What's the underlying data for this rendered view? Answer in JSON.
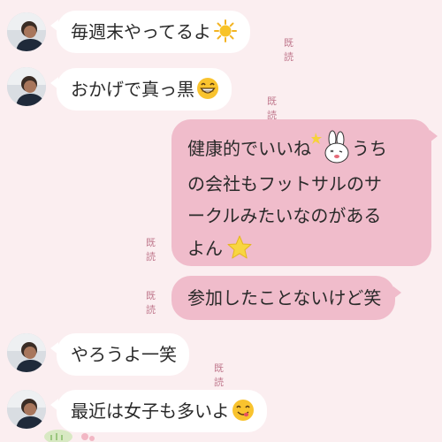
{
  "chat": {
    "read_label": "既読",
    "messages": [
      {
        "id": "m1",
        "direction": "incoming",
        "text": "毎週末やってるよ",
        "emoji": "sun-icon"
      },
      {
        "id": "m2",
        "direction": "incoming",
        "text": "おかげで真っ黒",
        "emoji": "grin-face-icon"
      },
      {
        "id": "m3",
        "direction": "outgoing",
        "lines": [
          "健康的でいいね",
          "うち",
          "の会社もフットサルのサ",
          "ークルみたいなのがある",
          "よん"
        ],
        "emoji": [
          "bunny-sticker-icon",
          "star-icon"
        ]
      },
      {
        "id": "m4",
        "direction": "outgoing",
        "text": "参加したことないけど笑"
      },
      {
        "id": "m5",
        "direction": "incoming",
        "text": "やろうよ一笑"
      },
      {
        "id": "m6",
        "direction": "incoming",
        "text": "最近は女子も多いよ",
        "emoji": "yum-face-icon"
      }
    ]
  },
  "colors": {
    "background": "#fbeef0",
    "incoming_bubble": "#ffffff",
    "outgoing_bubble": "#f0bccb",
    "read_receipt": "#c0798e"
  }
}
